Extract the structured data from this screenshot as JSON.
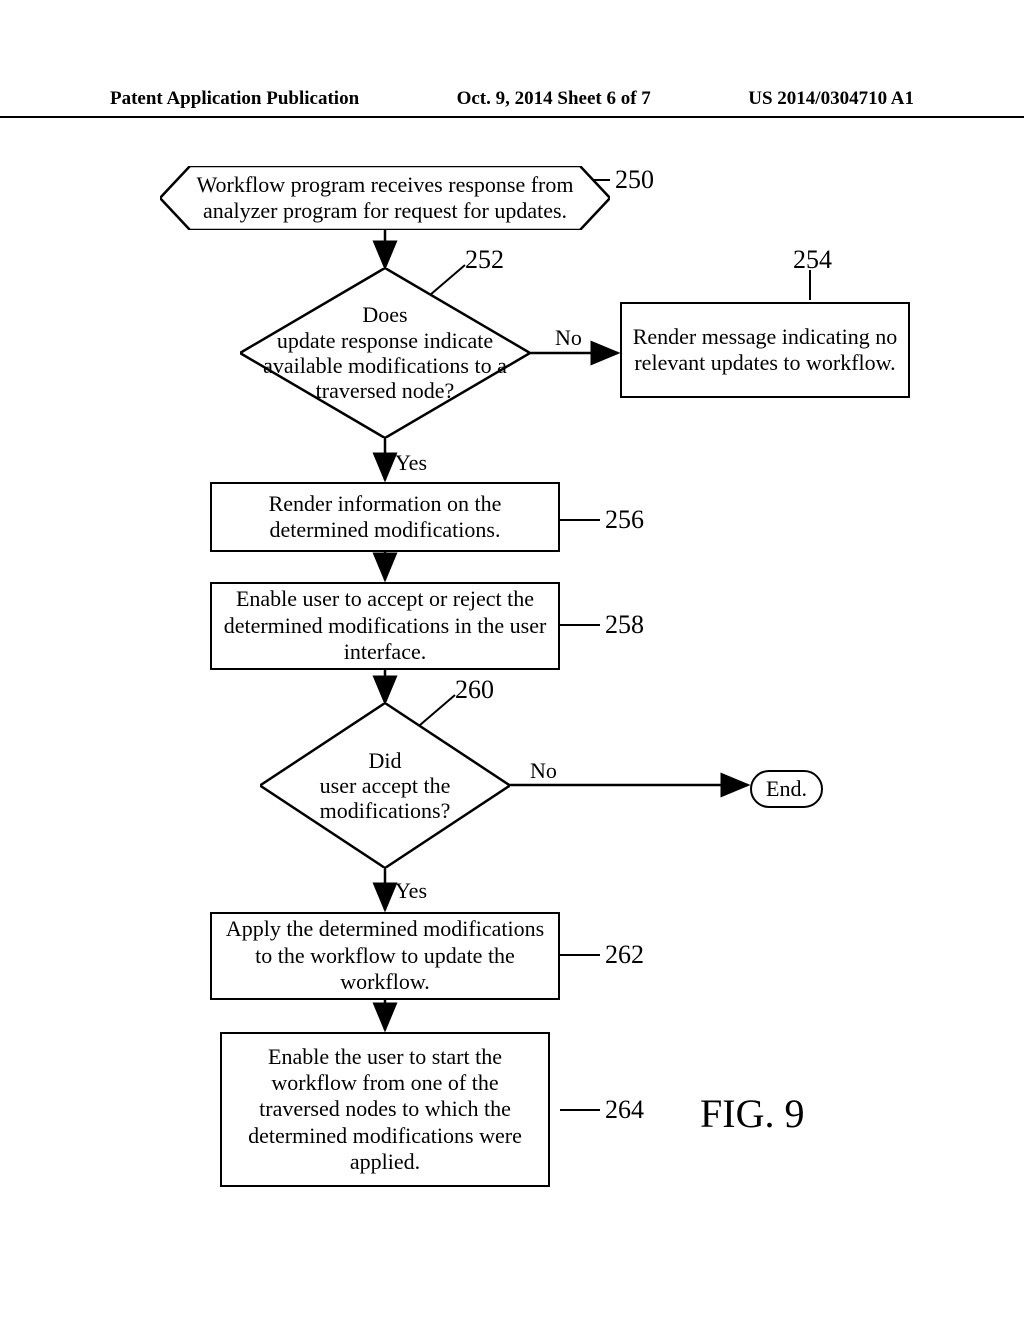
{
  "header": {
    "left": "Patent Application Publication",
    "center": "Oct. 9, 2014   Sheet 6 of 7",
    "right": "US 2014/0304710 A1"
  },
  "refs": {
    "r250": "250",
    "r252": "252",
    "r254": "254",
    "r256": "256",
    "r258": "258",
    "r260": "260",
    "r262": "262",
    "r264": "264"
  },
  "nodes": {
    "start": "Workflow program receives response from analyzer program for request for updates.",
    "d252": "Does\nupdate response indicate\navailable modifications to a\ntraversed node?",
    "b254": "Render message indicating no relevant updates to workflow.",
    "b256": "Render information on the determined modifications.",
    "b258": "Enable user to accept or reject the determined modifications in the user interface.",
    "d260": "Did\nuser accept the\nmodifications?",
    "end": "End.",
    "b262": "Apply the determined modifications to the workflow to update the workflow.",
    "b264": "Enable the user to start the workflow from one of the traversed nodes to which the determined modifications were applied."
  },
  "labels": {
    "yes": "Yes",
    "no": "No"
  },
  "figure": "FIG. 9"
}
